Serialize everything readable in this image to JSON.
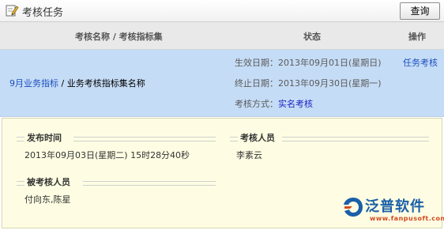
{
  "window": {
    "title": "考核任务",
    "query_button": "查询"
  },
  "columns": [
    "考核名称 / 考核指标集",
    "状态",
    "操作"
  ],
  "task": {
    "name_link": "9月业务指标",
    "name_rest": " / 业务考核指标集名称",
    "start_label": "生效日期：",
    "start_value": "2013年09月01日(星期日)",
    "end_label": "终止日期：",
    "end_value": "2013年09月30日(星期一)",
    "method_label": "考核方式：",
    "method_value": "实名考核",
    "operation": "任务考核"
  },
  "details": {
    "publish_time_label": "发布时间",
    "publish_time_value": "2013年09月03日(星期二) 15时28分40秒",
    "assessor_label": "考核人员",
    "assessor_value": "李素云",
    "assessee_label": "被考核人员",
    "assessee_value": "付向东,陈星"
  },
  "watermark": {
    "brand": "泛普软件",
    "url": "www.fanpusoft.com"
  },
  "colors": {
    "selected_row": "#c5dcf6",
    "detail_bg": "#fefde3",
    "link": "#1a4fbf",
    "brand_blue": "#1b5fa8",
    "brand_orange": "#d24a1e"
  }
}
